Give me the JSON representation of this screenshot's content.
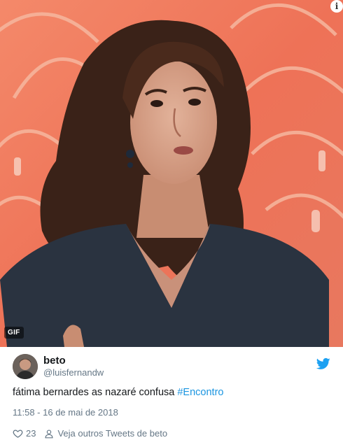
{
  "media": {
    "badge": "GIF",
    "info_symbol": "i",
    "colors": {
      "background": "#f07a5c",
      "hair": "#3a2218",
      "dress": "#2a3340",
      "skin": "#d9a48c"
    }
  },
  "tweet": {
    "display_name": "beto",
    "handle": "@luisfernandw",
    "text_plain": "fátima bernardes as nazaré confusa ",
    "hashtag": "#Encontro",
    "timestamp": "11:58 - 16 de mai de 2018",
    "like_count": "23",
    "see_more": "Veja outros Tweets de beto",
    "colors": {
      "link": "#1b95e0",
      "muted": "#657786",
      "like": "#e0245e"
    }
  }
}
